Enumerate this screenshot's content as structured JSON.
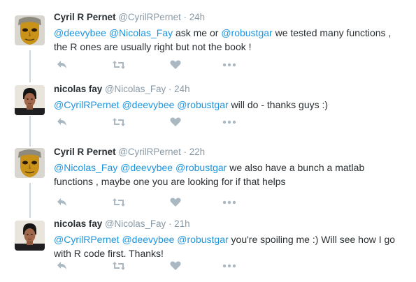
{
  "colors": {
    "link": "#1b95e0",
    "text": "#292f33",
    "meta": "#8899a6",
    "action_icon": "#aab8c2",
    "thread_line": "#ccd6dd"
  },
  "tweets": [
    {
      "fullname": "Cyril R Pernet",
      "username": "@CyrilRPernet",
      "dot": "·",
      "time": "24h",
      "avatar": "mask-avatar",
      "line1": [
        {
          "text": "@deevybee",
          "mention": true
        },
        {
          "text": " ",
          "mention": false
        },
        {
          "text": "@Nicolas_Fay",
          "mention": true
        },
        {
          "text": " ask me or ",
          "mention": false
        },
        {
          "text": "@robustgar",
          "mention": true
        },
        {
          "text": " we tested many functions ,",
          "mention": false
        }
      ],
      "line2": [
        {
          "text": "the R ones are usually right but not the book !",
          "mention": false
        }
      ]
    },
    {
      "fullname": "nicolas fay",
      "username": "@Nicolas_Fay",
      "dot": "·",
      "time": "24h",
      "avatar": "person-avatar",
      "line1": [
        {
          "text": "@CyrilRPernet",
          "mention": true
        },
        {
          "text": " ",
          "mention": false
        },
        {
          "text": "@deevybee",
          "mention": true
        },
        {
          "text": " ",
          "mention": false
        },
        {
          "text": "@robustgar",
          "mention": true
        },
        {
          "text": " will do - thanks guys :)",
          "mention": false
        }
      ],
      "line2": []
    },
    {
      "fullname": "Cyril R Pernet",
      "username": "@CyrilRPernet",
      "dot": "·",
      "time": "22h",
      "avatar": "mask-avatar",
      "line1": [
        {
          "text": "@Nicolas_Fay",
          "mention": true
        },
        {
          "text": " ",
          "mention": false
        },
        {
          "text": "@deevybee",
          "mention": true
        },
        {
          "text": " ",
          "mention": false
        },
        {
          "text": "@robustgar",
          "mention": true
        },
        {
          "text": " we also have a bunch a matlab",
          "mention": false
        }
      ],
      "line2": [
        {
          "text": "functions , maybe one you are looking for if that helps",
          "mention": false
        }
      ]
    },
    {
      "fullname": "nicolas fay",
      "username": "@Nicolas_Fay",
      "dot": "·",
      "time": "21h",
      "avatar": "person-avatar",
      "line1": [
        {
          "text": "@CyrilRPernet",
          "mention": true
        },
        {
          "text": " ",
          "mention": false
        },
        {
          "text": "@deevybee",
          "mention": true
        },
        {
          "text": " ",
          "mention": false
        },
        {
          "text": "@robustgar",
          "mention": true
        },
        {
          "text": " you're spoiling me :) Will see how I go",
          "mention": false
        }
      ],
      "line2": [
        {
          "text": "with R code first. Thanks!",
          "mention": false
        }
      ]
    }
  ],
  "actions": [
    {
      "name": "reply-icon"
    },
    {
      "name": "retweet-icon"
    },
    {
      "name": "like-icon"
    },
    {
      "name": "more-icon"
    }
  ]
}
